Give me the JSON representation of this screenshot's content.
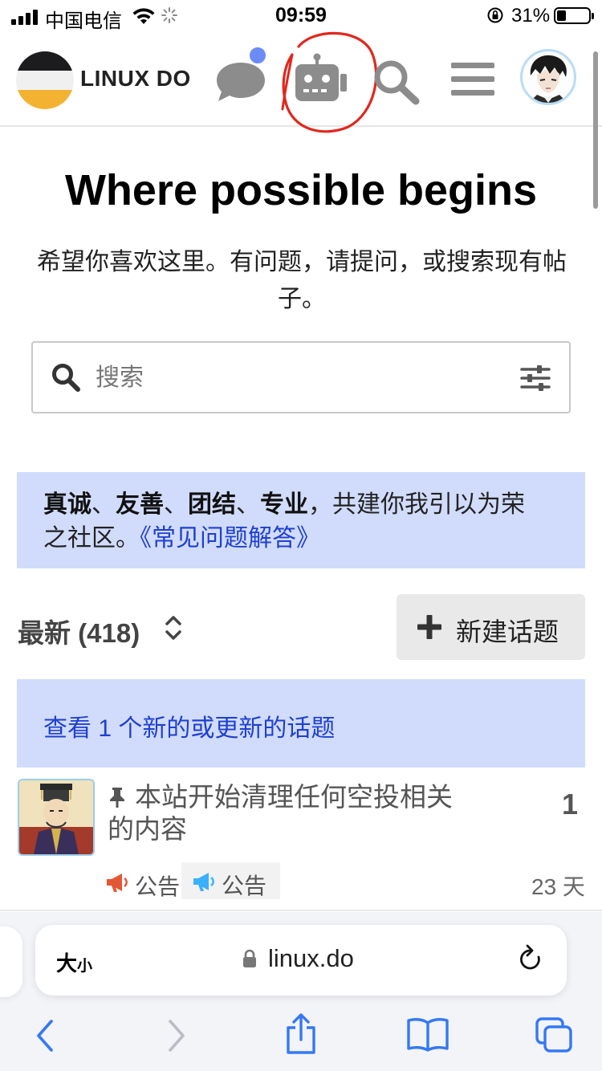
{
  "status_bar": {
    "carrier": "中国电信",
    "time": "09:59",
    "battery": "31%",
    "battery_level": 0.31
  },
  "header": {
    "site_title": "LINUX DO",
    "icons": [
      "chat-icon",
      "robot-icon",
      "search-icon",
      "menu-icon",
      "user-avatar"
    ],
    "chat_unread_dot_color": "#6b8cf5",
    "annotation_color": "#e0281e"
  },
  "hero": {
    "title": "Where possible begins",
    "subtitle": "希望你喜欢这里。有问题，请提问，或搜索现有帖子。"
  },
  "search": {
    "placeholder": "搜索"
  },
  "banner": {
    "values": [
      "真诚",
      "友善",
      "团结",
      "专业"
    ],
    "separator": "、",
    "rest": "，共建你我引以为荣之社区。",
    "faq_link": "《常见问题解答》"
  },
  "list": {
    "filter_label": "最新 (418)",
    "new_topic_label": "新建话题",
    "new_topics_notice": "查看 1 个新的或更新的话题",
    "topics": [
      {
        "title": "本站开始清理任何空投相关的内容",
        "pinned": true,
        "replies": "1",
        "category": "公告",
        "tag": "公告",
        "age": "23 天"
      }
    ]
  },
  "safari": {
    "text_size_label_big": "大",
    "text_size_label_small": "小",
    "url": "linux.do"
  },
  "colors": {
    "accent_blue": "#1f3fd1",
    "banner_bg": "#d1dcfc",
    "safari_blue": "#3478f6",
    "category_orange": "#e45735",
    "tag_blue": "#3ab0ff"
  }
}
